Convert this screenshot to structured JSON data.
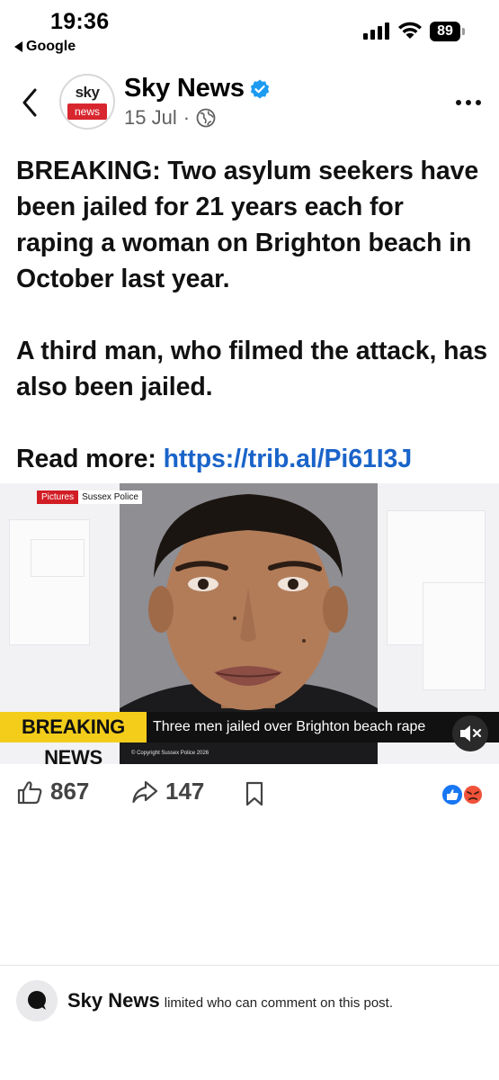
{
  "status_bar": {
    "time": "19:36",
    "back_app": "Google",
    "battery": "89"
  },
  "post": {
    "page_name": "Sky News",
    "avatar": {
      "sky": "sky",
      "news": "news"
    },
    "date": "15 Jul",
    "separator": "·",
    "paragraphs": [
      "BREAKING: Two asylum seekers have been jailed for 21 years each for raping a woman on Brighton beach in October last year.",
      "A third man, who filmed the attack, has also been jailed."
    ],
    "read_more_label": "Read more:",
    "link": "https://trib.al/Pi61I3J"
  },
  "media": {
    "credit_label": "Pictures",
    "credit_source": "Sussex Police",
    "breaking_label": "BREAKING NEWS",
    "headline": "Three men jailed over Brighton beach rape",
    "copyright": "© Copyright Sussex Police 2026"
  },
  "actions": {
    "like_count": "867",
    "share_count": "147"
  },
  "comments": {
    "page_name": "Sky News",
    "restriction_text": "limited who can comment on this post."
  },
  "colors": {
    "link": "#1a64c9",
    "breaking_yellow": "#f3cd1a",
    "verified_blue": "#1d9bf0",
    "sky_red": "#d8262f"
  }
}
